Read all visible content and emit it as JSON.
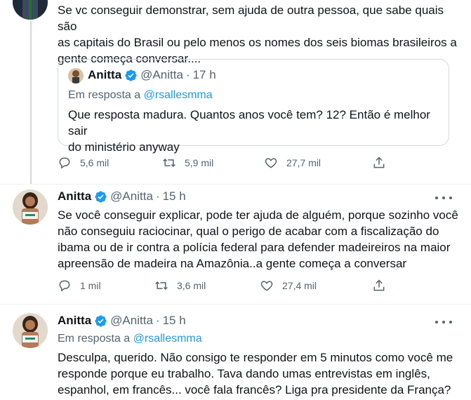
{
  "tweet1": {
    "body": "Se vc conseguir demonstrar, sem ajuda de outra pessoa, que sabe quais são\nas capitais do Brasil ou pelo menos os nomes dos seis biomas brasileiros a\ngente começa conversar....",
    "quote": {
      "name": "Anitta",
      "handle": "@Anitta",
      "dot": "·",
      "time": "17 h",
      "reply_prefix": "Em resposta a",
      "reply_mention": "@rsallesmma",
      "body": "Que resposta madura. Quantos anos você tem? 12? Então é melhor sair\ndo ministério anyway"
    },
    "replies": "5,6 mil",
    "retweets": "5,9 mil",
    "likes": "27,7 mil"
  },
  "tweet2": {
    "name": "Anitta",
    "handle": "@Anitta",
    "dot": "·",
    "time": "15 h",
    "body": "Se você conseguir explicar, pode ter ajuda de alguém, porque sozinho você\nnão conseguiu raciocinar, qual o perigo de acabar com a fiscalização do\nibama ou de ir contra a polícia federal para defender madeireiros na maior\napreensão de madeira na Amazônia..a gente começa a conversar",
    "replies": "1 mil",
    "retweets": "3,6 mil",
    "likes": "27,4 mil"
  },
  "tweet3": {
    "name": "Anitta",
    "handle": "@Anitta",
    "dot": "·",
    "time": "15 h",
    "reply_prefix": "Em resposta a",
    "reply_mention": "@rsallesmma",
    "body": "Desculpa, querido. Não consigo te responder em 5 minutos como você me\nresponde porque eu trabalho. Tava dando umas entrevistas em inglês,\nespanhol, em francês... você fala francês? Liga pra presidente da França?"
  },
  "icons": {
    "reply": "reply-icon",
    "retweet": "retweet-icon",
    "like": "heart-icon",
    "share": "share-icon",
    "verified": "verified-badge-icon",
    "more": "more-icon"
  },
  "colors": {
    "accent": "#1d9bf0",
    "secondary_text": "#536471",
    "border": "#cfd9de"
  }
}
